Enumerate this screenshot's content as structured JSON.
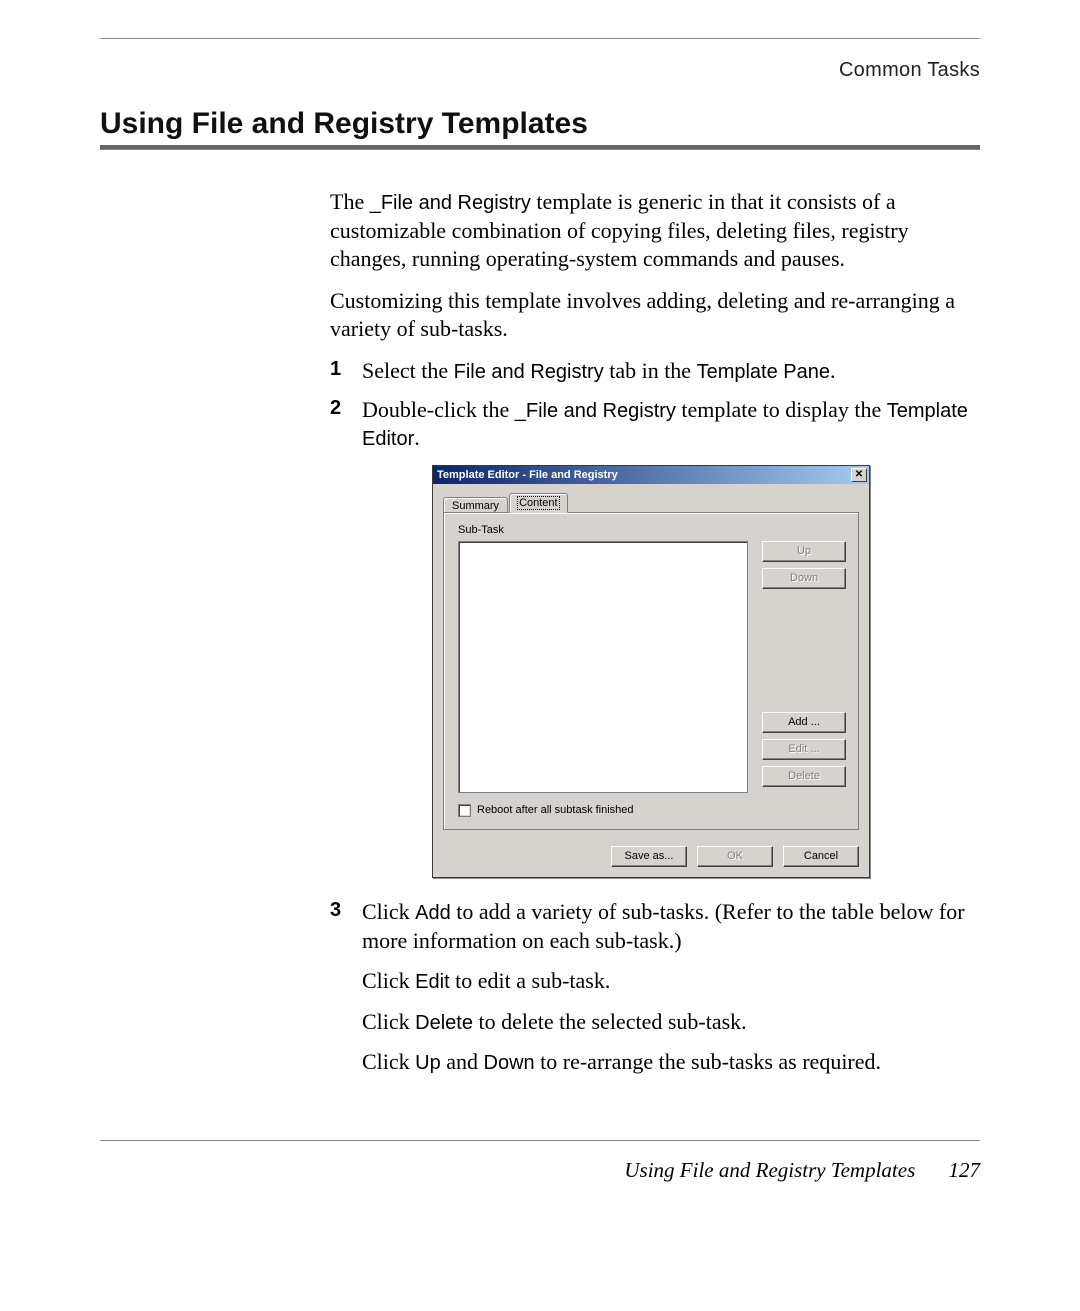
{
  "header": {
    "right": "Common Tasks"
  },
  "section": {
    "title": "Using File and Registry Templates"
  },
  "intro": {
    "p1_a": "The ",
    "p1_code": "_File and Registry",
    "p1_b": " template is generic in that it consists of a customizable combination of copying files, deleting files, registry changes, running operating-system commands and pauses.",
    "p2": "Customizing this template involves adding, deleting and re-arranging a variety of sub-tasks."
  },
  "steps": [
    {
      "num": "1",
      "parts": [
        {
          "t": "Select the "
        },
        {
          "t": "File and Registry",
          "sans": true
        },
        {
          "t": " tab in the "
        },
        {
          "t": "Template Pane",
          "sans": true
        },
        {
          "t": "."
        }
      ]
    },
    {
      "num": "2",
      "parts": [
        {
          "t": "Double-click the "
        },
        {
          "t": "_File and Registry",
          "sans": true
        },
        {
          "t": " template to display the "
        },
        {
          "t": "Template Editor",
          "sans": true
        },
        {
          "t": "."
        }
      ]
    },
    {
      "num": "3",
      "parts": [
        {
          "t": "Click "
        },
        {
          "t": "Add",
          "sans": true
        },
        {
          "t": " to add a variety of sub-tasks. (Refer to the table below for more information on each sub-task.)"
        }
      ],
      "subs": [
        [
          {
            "t": "Click "
          },
          {
            "t": "Edit",
            "sans": true
          },
          {
            "t": " to edit a sub-task."
          }
        ],
        [
          {
            "t": "Click "
          },
          {
            "t": "Delete",
            "sans": true
          },
          {
            "t": " to delete the selected sub-task."
          }
        ],
        [
          {
            "t": "Click "
          },
          {
            "t": "Up",
            "sans": true
          },
          {
            "t": " and "
          },
          {
            "t": "Down",
            "sans": true
          },
          {
            "t": " to re-arrange the sub-tasks as required."
          }
        ]
      ]
    }
  ],
  "dialog": {
    "title": "Template Editor - File and Registry",
    "close_glyph": "✕",
    "tabs": {
      "summary": "Summary",
      "content": "Content"
    },
    "subtask_label": "Sub-Task",
    "buttons": {
      "up": "Up",
      "down": "Down",
      "add": "Add ...",
      "edit": "Edit ...",
      "delete": "Delete",
      "save_as": "Save as...",
      "ok": "OK",
      "cancel": "Cancel"
    },
    "reboot_label": "Reboot after all subtask finished"
  },
  "footer": {
    "title": "Using File and Registry Templates",
    "page": "127"
  }
}
